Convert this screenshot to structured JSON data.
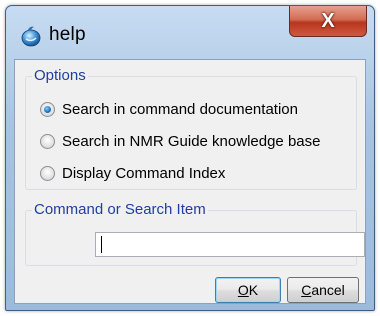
{
  "window": {
    "title": "help",
    "close_label": "X"
  },
  "options": {
    "group_label": "Options",
    "items": [
      {
        "label": "Search in command documentation",
        "checked": true
      },
      {
        "label": "Search in NMR Guide knowledge base",
        "checked": false
      },
      {
        "label": "Display Command Index",
        "checked": false
      }
    ]
  },
  "search": {
    "group_label": "Command or Search Item",
    "value": ""
  },
  "buttons": {
    "ok": {
      "mnemonic": "O",
      "rest": "K"
    },
    "cancel": {
      "mnemonic": "C",
      "rest": "ancel"
    }
  },
  "colors": {
    "group_title": "#1f3f9e",
    "close_button": "#c9452a",
    "radio_selected": "#1d6fc2"
  }
}
